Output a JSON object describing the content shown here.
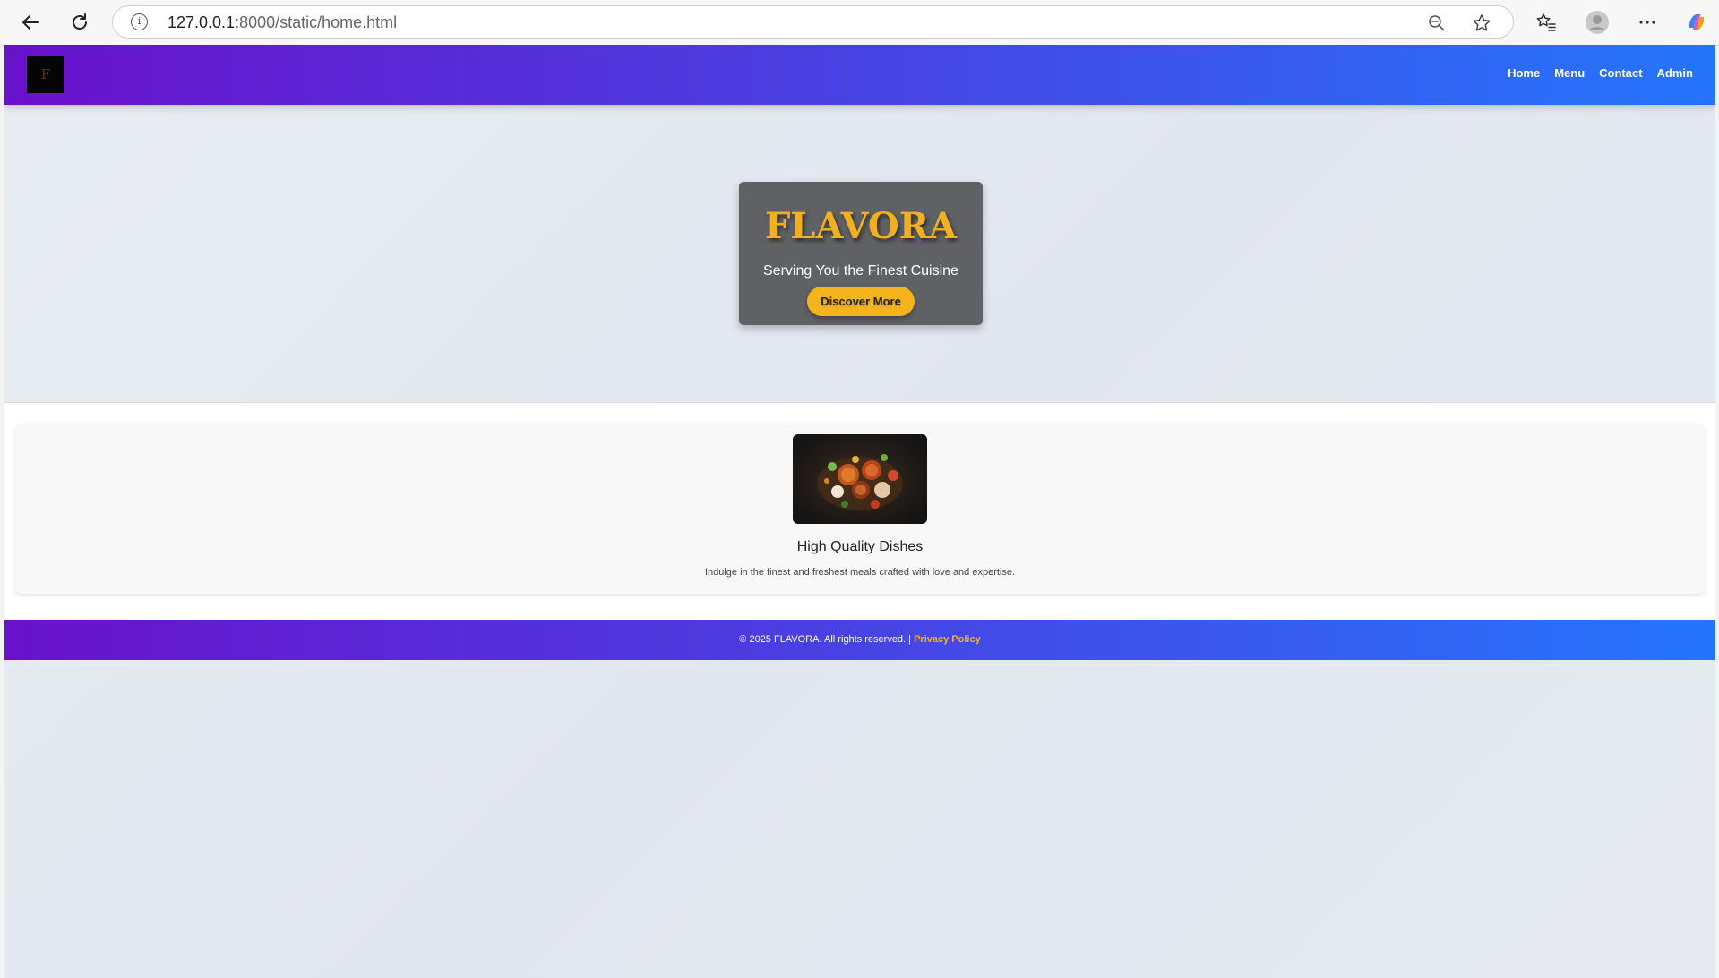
{
  "browser": {
    "address_host": "127.0.0.1",
    "address_path": ":8000/static/home.html",
    "icons": [
      "back-arrow-icon",
      "reload-icon",
      "site-info-icon",
      "zoom-out-icon",
      "favorite-star-icon",
      "favorites-list-icon",
      "profile-icon",
      "more-icon",
      "copilot-icon"
    ]
  },
  "navbar": {
    "logo": "logo",
    "links": [
      "Home",
      "Menu",
      "Contact",
      "Admin"
    ]
  },
  "hero": {
    "title": "FLAVORA",
    "subtitle": "Serving You the Finest Cuisine",
    "button": "Discover More"
  },
  "feature": {
    "title": "High Quality Dishes",
    "description": "Indulge in the finest and freshest meals crafted with love and expertise."
  },
  "footer": {
    "text": "© 2025 FLAVORA. All rights reserved. | ",
    "link": "Privacy Policy"
  },
  "colors": {
    "accent": "#f6b41c",
    "gradient_start": "#6a11cb",
    "gradient_end": "#2575fc"
  }
}
